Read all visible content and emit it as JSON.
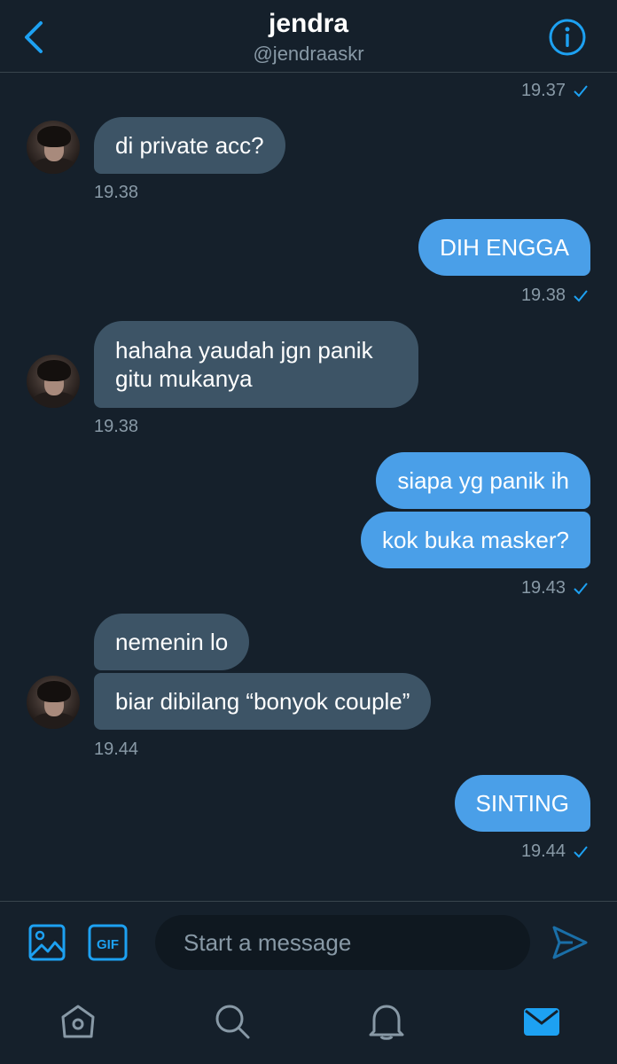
{
  "header": {
    "title": "jendra",
    "handle": "@jendraaskr"
  },
  "messages": [
    {
      "type": "stamp-sent",
      "time": "19.37"
    },
    {
      "type": "received",
      "text": "di private acc?",
      "time": "19.38"
    },
    {
      "type": "sent",
      "text": "DIH ENGGA",
      "time": "19.38"
    },
    {
      "type": "received",
      "text": "hahaha yaudah jgn panik gitu mukanya",
      "time": "19.38"
    },
    {
      "type": "sent",
      "text": "siapa yg panik ih"
    },
    {
      "type": "sent",
      "text": "kok buka masker?",
      "time": "19.43"
    },
    {
      "type": "received",
      "text": "nemenin lo"
    },
    {
      "type": "received",
      "text": "biar dibilang “bonyok couple”",
      "time": "19.44"
    },
    {
      "type": "sent",
      "text": "SINTING",
      "time": "19.44"
    }
  ],
  "composer": {
    "placeholder": "Start a message",
    "gif_label": "GIF"
  },
  "nav": [
    "home-icon",
    "search-icon",
    "notifications-icon",
    "messages-icon"
  ],
  "colors": {
    "background": "#15202b",
    "accent": "#1da1f2",
    "received_bubble": "#3d5466",
    "sent_bubble": "#4a9fe8",
    "muted_text": "#8899a6"
  }
}
